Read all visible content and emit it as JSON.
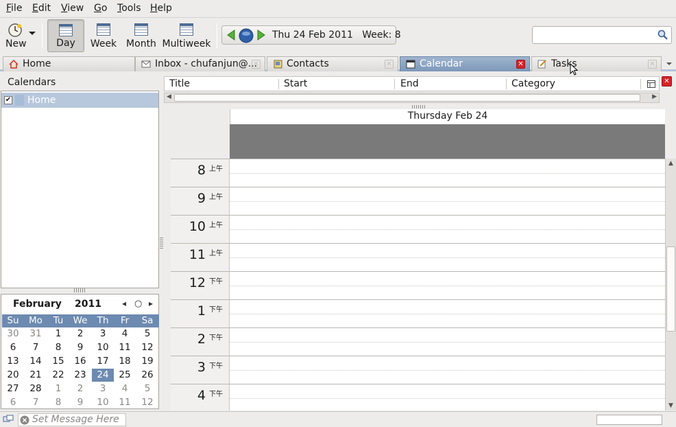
{
  "menu": [
    "File",
    "Edit",
    "View",
    "Go",
    "Tools",
    "Help"
  ],
  "menu_mnemonics": [
    "F",
    "E",
    "V",
    "G",
    "T",
    "H"
  ],
  "toolbar": {
    "new_label": "New",
    "day_label": "Day",
    "week_label": "Week",
    "month_label": "Month",
    "multiweek_label": "Multiweek",
    "date_display": "Thu 24 Feb 2011   Week: 8",
    "search_placeholder": ""
  },
  "tabs": [
    {
      "label": "Home",
      "icon": "home-icon"
    },
    {
      "label": "Inbox - chufanjun@...",
      "icon": "mail-icon"
    },
    {
      "label": "Contacts",
      "icon": "contacts-icon"
    },
    {
      "label": "Calendar",
      "icon": "calendar-icon"
    },
    {
      "label": "Tasks",
      "icon": "tasks-icon"
    }
  ],
  "sidebar": {
    "header": "Calendars",
    "calendars": [
      {
        "name": "Home",
        "checked": true,
        "color": "#a7bcd6"
      }
    ]
  },
  "minimonth": {
    "month": "February",
    "year": "2011",
    "weekdays": [
      "Su",
      "Mo",
      "Tu",
      "We",
      "Th",
      "Fr",
      "Sa"
    ],
    "weeks": [
      [
        "30",
        "31",
        "1",
        "2",
        "3",
        "4",
        "5"
      ],
      [
        "6",
        "7",
        "8",
        "9",
        "10",
        "11",
        "12"
      ],
      [
        "13",
        "14",
        "15",
        "16",
        "17",
        "18",
        "19"
      ],
      [
        "20",
        "21",
        "22",
        "23",
        "24",
        "25",
        "26"
      ],
      [
        "27",
        "28",
        "1",
        "2",
        "3",
        "4",
        "5"
      ],
      [
        "6",
        "7",
        "8",
        "9",
        "10",
        "11",
        "12"
      ]
    ],
    "today": "24"
  },
  "task_columns": [
    "Title",
    "Start",
    "End",
    "Category"
  ],
  "day_view": {
    "header": "Thursday Feb 24",
    "hours": [
      {
        "h": "8",
        "ampm": "上午"
      },
      {
        "h": "9",
        "ampm": "上午"
      },
      {
        "h": "10",
        "ampm": "上午"
      },
      {
        "h": "11",
        "ampm": "上午"
      },
      {
        "h": "12",
        "ampm": "下午"
      },
      {
        "h": "1",
        "ampm": "下午"
      },
      {
        "h": "2",
        "ampm": "下午"
      },
      {
        "h": "3",
        "ampm": "下午"
      },
      {
        "h": "4",
        "ampm": "下午"
      }
    ]
  },
  "status": {
    "message_placeholder": "Set Message Here"
  },
  "colors": {
    "accent": "#6d8ab0",
    "selected_tab": "#8ea6c6",
    "allday_band": "#7a7a7a",
    "close_red": "#d5232b"
  }
}
